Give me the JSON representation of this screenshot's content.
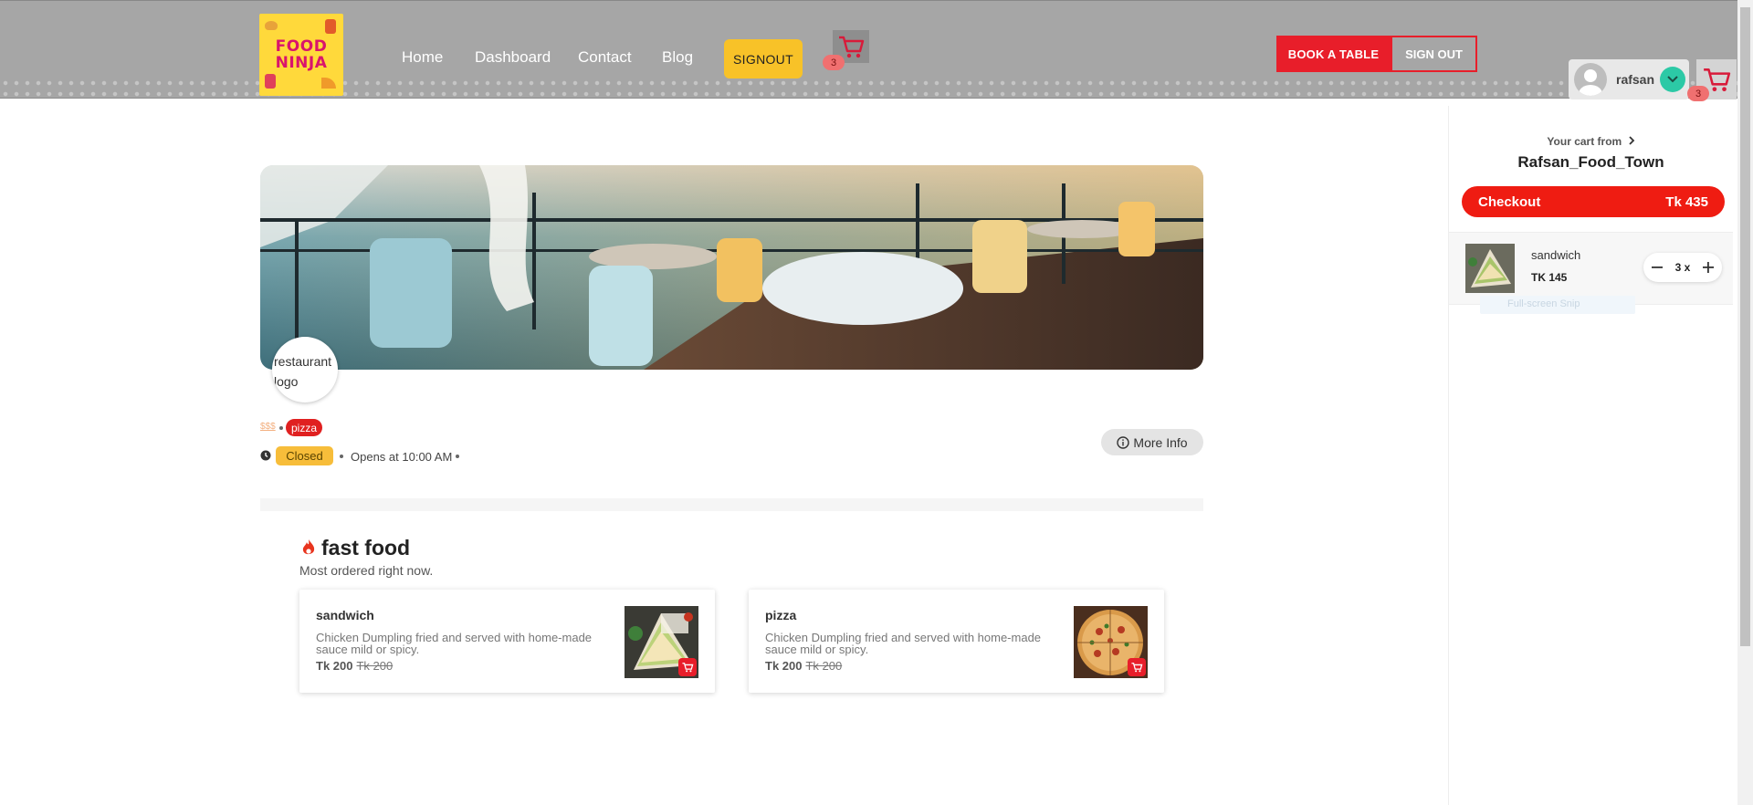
{
  "header": {
    "logo_line1": "FOOD",
    "logo_line2": "NINJA",
    "nav": [
      "Home",
      "Dashboard",
      "Contact",
      "Blog"
    ],
    "signout_label": "SIGNOUT",
    "cart_count": "3",
    "book_label": "BOOK A TABLE",
    "signout_outline_label": "SIGN OUT",
    "username": "rafsan",
    "cart_count_right": "3"
  },
  "restaurant": {
    "logo_alt": "restaurant logo",
    "price_range": "$$$",
    "tag": "pizza",
    "status": "Closed",
    "opens": "Opens at 10:00 AM",
    "more_info": "More Info"
  },
  "section": {
    "title": "fast food",
    "subtitle": "Most ordered right now.",
    "items": [
      {
        "name": "sandwich",
        "desc": "Chicken Dumpling fried and served with home-made sauce mild or spicy.",
        "price": "Tk 200",
        "old_price": "Tk 200"
      },
      {
        "name": "pizza",
        "desc": "Chicken Dumpling fried and served with home-made sauce mild or spicy.",
        "price": "Tk 200",
        "old_price": "Tk 200"
      }
    ]
  },
  "cart": {
    "from_label": "Your cart from",
    "restaurant": "Rafsan_Food_Town",
    "checkout_label": "Checkout",
    "total": "Tk 435",
    "item_name": "sandwich",
    "item_price": "TK 145",
    "item_qty": "3 x",
    "ghost_text": "Full-screen Snip"
  },
  "colors": {
    "accent_red": "#e81e2a",
    "accent_yellow": "#f8c228",
    "header_gray": "#a6a6a6",
    "teal": "#2cc9a6"
  }
}
